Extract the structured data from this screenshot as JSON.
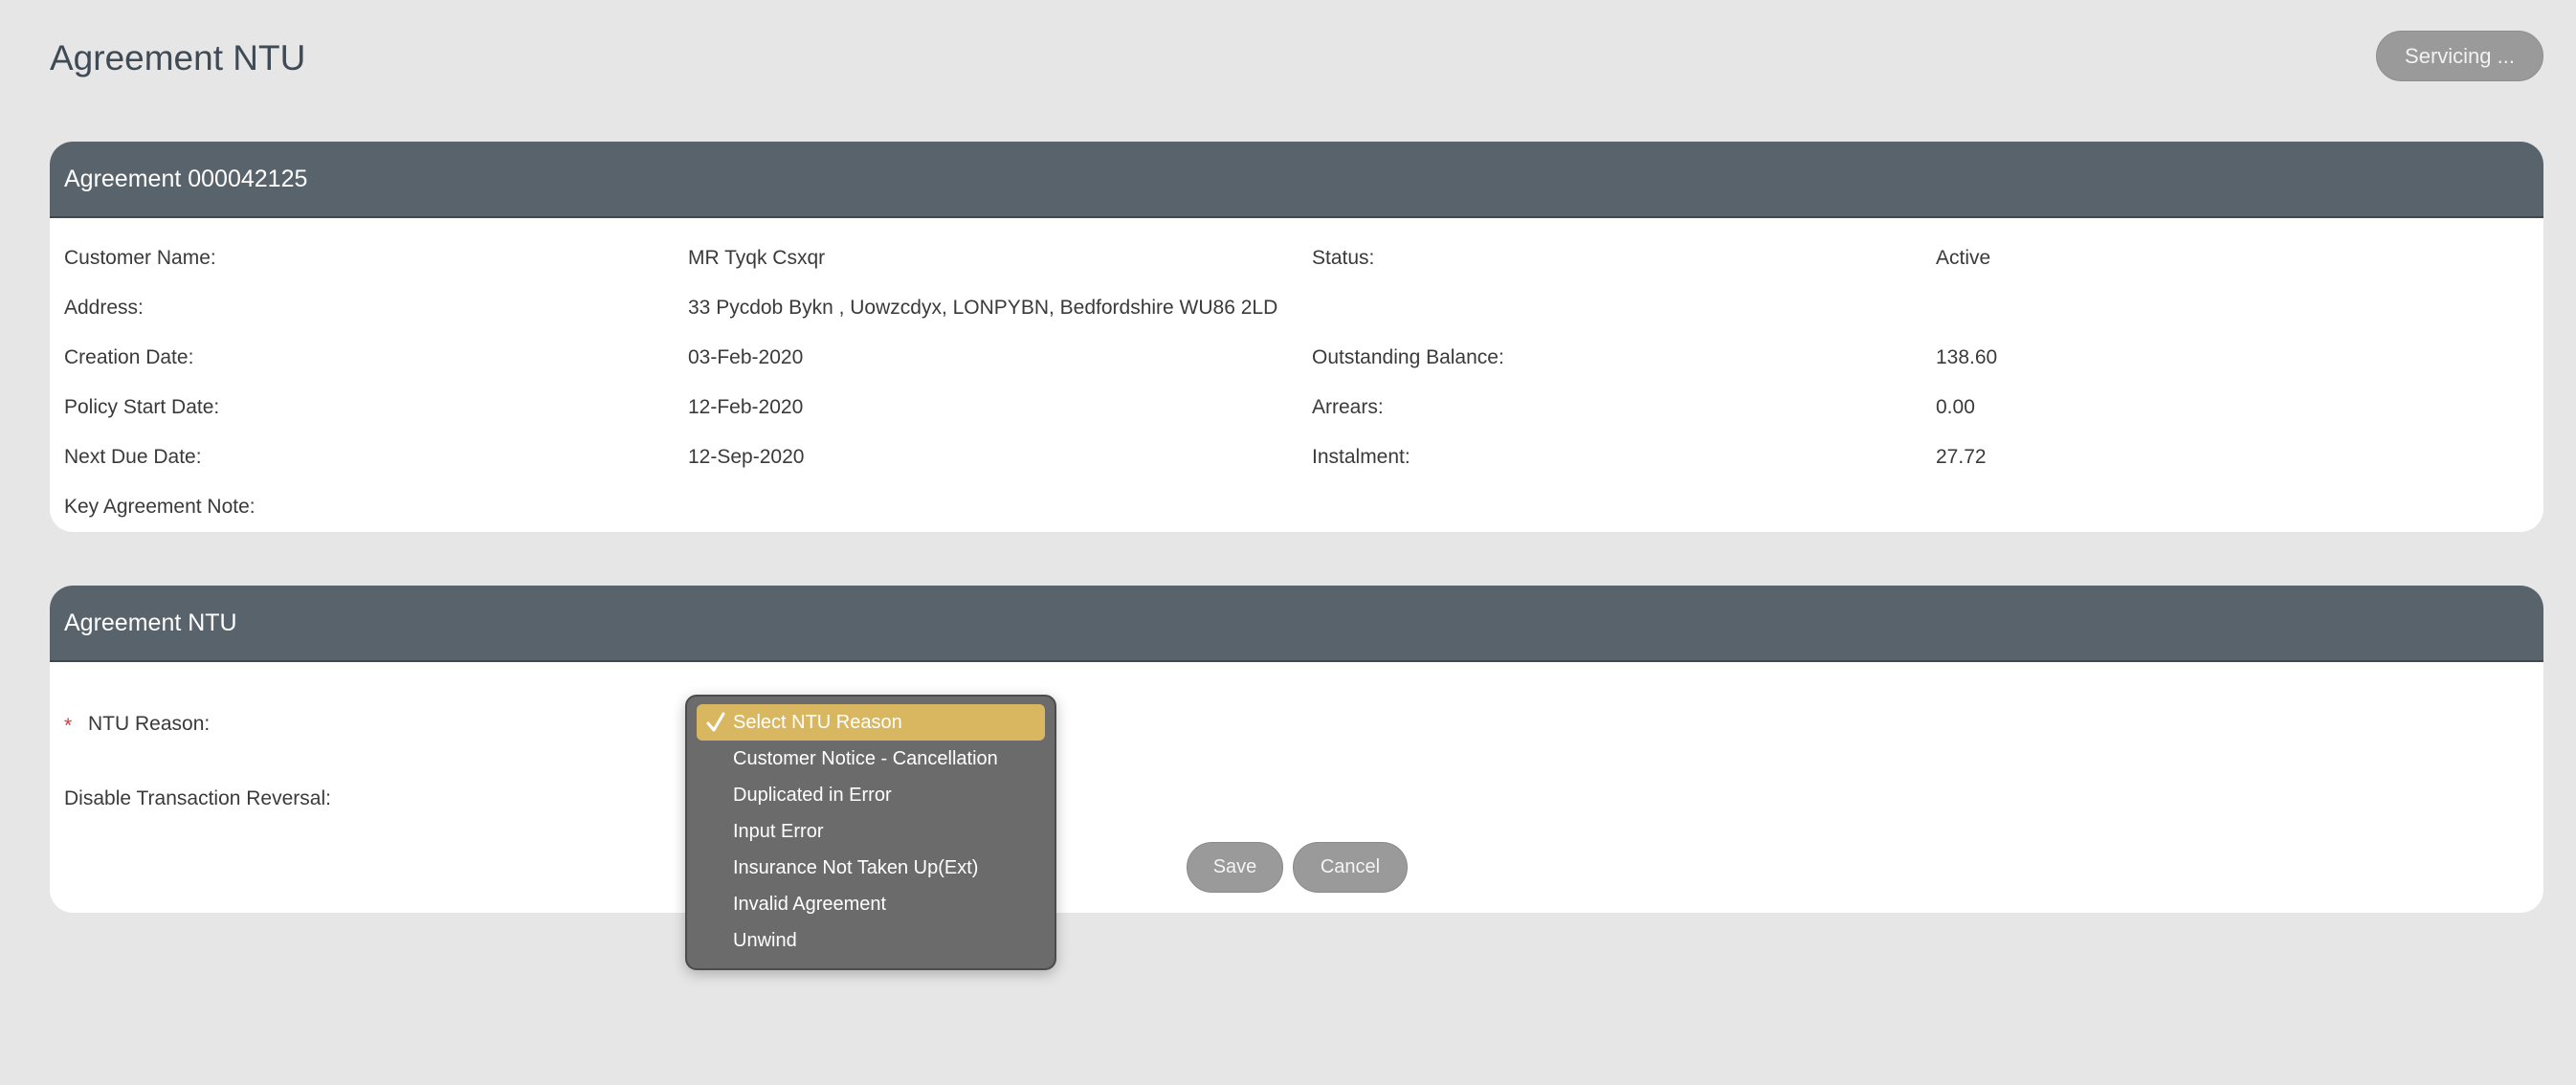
{
  "page": {
    "title": "Agreement NTU",
    "servicing_label": "Servicing ..."
  },
  "agreement_card": {
    "header": "Agreement 000042125",
    "fields": {
      "customer_name_label": "Customer Name:",
      "customer_name_value": "MR Tyqk Csxqr",
      "status_label": "Status:",
      "status_value": "Active",
      "address_label": "Address:",
      "address_value": "33 Pycdob Bykn , Uowzcdyx, LONPYBN, Bedfordshire WU86 2LD",
      "creation_date_label": "Creation Date:",
      "creation_date_value": "03-Feb-2020",
      "outstanding_balance_label": "Outstanding Balance:",
      "outstanding_balance_value": "138.60",
      "policy_start_date_label": "Policy Start Date:",
      "policy_start_date_value": "12-Feb-2020",
      "arrears_label": "Arrears:",
      "arrears_value": "0.00",
      "next_due_date_label": "Next Due Date:",
      "next_due_date_value": "12-Sep-2020",
      "instalment_label": "Instalment:",
      "instalment_value": "27.72",
      "key_note_label": "Key Agreement Note:"
    }
  },
  "ntu_card": {
    "header": "Agreement NTU",
    "required_marker": "*",
    "ntu_reason_label": "NTU Reason:",
    "disable_reversal_label": "Disable Transaction Reversal:",
    "save_label": "Save",
    "cancel_label": "Cancel"
  },
  "ntu_dropdown": {
    "options": [
      "Select NTU Reason",
      "Customer Notice - Cancellation",
      "Duplicated in Error",
      "Input Error",
      "Insurance Not Taken Up(Ext)",
      "Invalid Agreement",
      "Unwind"
    ],
    "selected_index": 0,
    "highlight_color": "#d9b761"
  }
}
